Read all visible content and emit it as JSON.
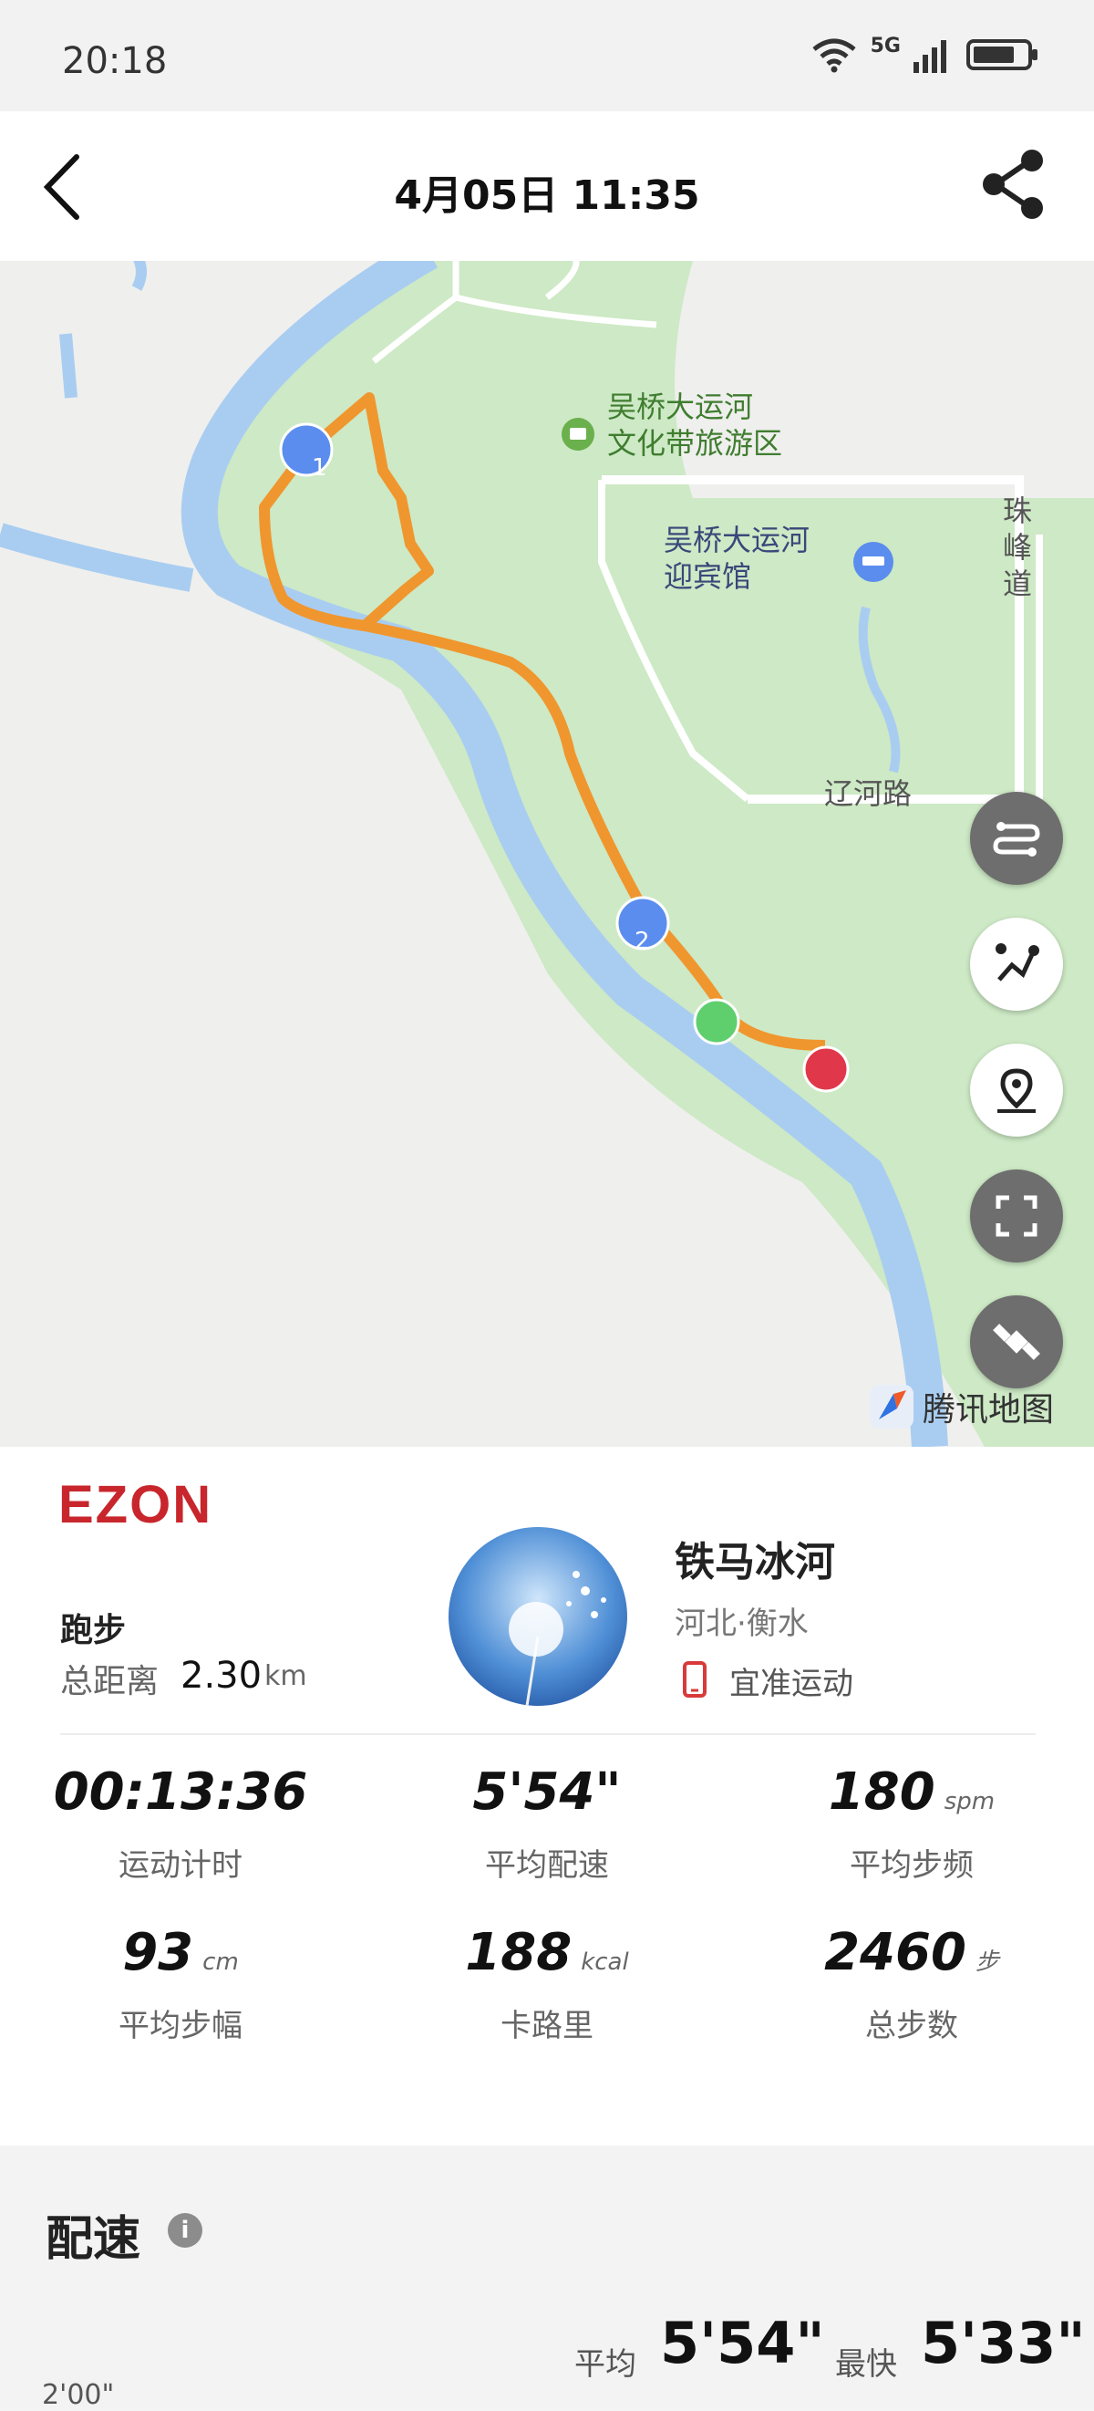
{
  "status_bar": {
    "time": "20:18",
    "network": "5G"
  },
  "header": {
    "title": "4月05日  11:35"
  },
  "map": {
    "labels": {
      "scenic_area": "吴桥大运河\n文化带旅游区",
      "hotel": "吴桥大运河\n迎宾馆",
      "road_liaohe": "辽河路",
      "road_zhufeng": "珠\n峰\n道"
    },
    "markers": {
      "km1": "1",
      "km2": "2"
    },
    "provider": "腾讯地图",
    "colors": {
      "route": "#f0962e",
      "start": "#5fcf6e",
      "end": "#e0384a",
      "marker": "#5b8def",
      "park": "#cde9c5",
      "water": "#a9cdf1"
    }
  },
  "summary": {
    "brand": "EZON",
    "sport_type": "跑步",
    "distance_label": "总距离",
    "distance_value": "2.30",
    "distance_unit": "km",
    "user_name": "铁马冰河",
    "user_location": "河北·衡水",
    "device": "宜准运动",
    "stats": [
      {
        "value": "00:13:36",
        "unit": "",
        "label": "运动计时"
      },
      {
        "value": "5'54\"",
        "unit": "",
        "label": "平均配速"
      },
      {
        "value": "180",
        "unit": "spm",
        "label": "平均步频"
      },
      {
        "value": "93",
        "unit": "cm",
        "label": "平均步幅"
      },
      {
        "value": "188",
        "unit": "kcal",
        "label": "卡路里"
      },
      {
        "value": "2460",
        "unit": "步",
        "label": "总步数"
      }
    ]
  },
  "pace": {
    "title": "配速",
    "avg_label": "平均",
    "avg_value": "5'54\"",
    "best_label": "最快",
    "best_value": "5'33\"",
    "axis_tick": "2'00\""
  }
}
